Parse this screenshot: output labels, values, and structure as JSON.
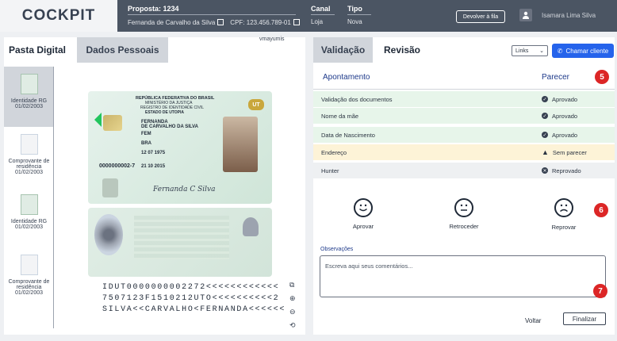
{
  "header": {
    "logo": "COCKPIT",
    "proposal_title": "Proposta: 1234",
    "client_name": "Fernanda de Carvalho da Silva",
    "cpf": "CPF: 123.456.789-01",
    "canal_label": "Canal",
    "canal_value": "Loja",
    "tipo_label": "Tipo",
    "tipo_value": "Nova",
    "return_button": "Devolver à fila",
    "user_name": "Isamara Lima Silva"
  },
  "left": {
    "tabs": [
      {
        "label": "Pasta Digital",
        "active": true
      },
      {
        "label": "Dados Pessoais",
        "active": false
      }
    ],
    "thumbnails": [
      {
        "label": "Identidade RG",
        "date": "01/02/2003",
        "selected": true
      },
      {
        "label": "Comprovante de residência",
        "date": "01/02/2003",
        "selected": false
      },
      {
        "label": "Identidade RG",
        "date": "01/02/2003",
        "selected": false
      },
      {
        "label": "Comprovante de residência",
        "date": "01/02/2003",
        "selected": false
      }
    ],
    "watermark_user": "vmayumis",
    "card": {
      "country": "REPÚBLICA FEDERATIVA DO BRASIL",
      "ministry": "MINISTÉRIO DA JUSTIÇA",
      "registry": "REGISTRO DE IDENTIDADE CIVIL",
      "state": "ESTADO DE UTOPIA",
      "badge": "UT",
      "name_line1": "FERNANDA",
      "name_line2": "DE CARVALHO DA SILVA",
      "sex": "FEM",
      "nationality": "BRA",
      "birth": "12 07 1975",
      "number": "0000000002-7",
      "validity": "21 10 2015",
      "signature": "Fernanda C Silva"
    },
    "mrz": [
      "IDUT0000000002272<<<<<<<<<<<<",
      "7507123F1510212UTO<<<<<<<<<<2",
      "SILVA<<CARVALHO<FERNANDA<<<<<<"
    ],
    "tools": [
      "external-link-icon",
      "zoom-in-icon",
      "zoom-out-icon",
      "rotate-icon"
    ]
  },
  "right": {
    "tabs": [
      {
        "label": "Validação",
        "active": false
      },
      {
        "label": "Revisão",
        "active": true
      }
    ],
    "links_select": "Links",
    "call_button": "Chamar cliente",
    "header_apontamento": "Apontamento",
    "header_parecer": "Parecer",
    "markers": [
      "5",
      "6",
      "7"
    ],
    "rows": [
      {
        "label": "Validação dos documentos",
        "status": "Aprovado",
        "tone": "green",
        "icon": "check-circle-icon"
      },
      {
        "label": "Nome da mãe",
        "status": "Aprovado",
        "tone": "green",
        "icon": "check-circle-icon"
      },
      {
        "label": "Data de Nascimento",
        "status": "Aprovado",
        "tone": "green",
        "icon": "check-circle-icon"
      },
      {
        "label": "Endereço",
        "status": "Sem parecer",
        "tone": "yellow",
        "icon": "warning-icon"
      },
      {
        "label": "Hunter",
        "status": "Reprovado",
        "tone": "grey",
        "icon": "x-circle-icon"
      }
    ],
    "actions": [
      {
        "label": "Aprovar",
        "icon": "smile-face-icon"
      },
      {
        "label": "Retroceder",
        "icon": "neutral-face-icon"
      },
      {
        "label": "Reprovar",
        "icon": "sad-face-icon"
      }
    ],
    "observations_label": "Observações",
    "observations_placeholder": "Escreva aqui seus comentários...",
    "back_button": "Voltar",
    "finish_button": "Finalizar"
  }
}
